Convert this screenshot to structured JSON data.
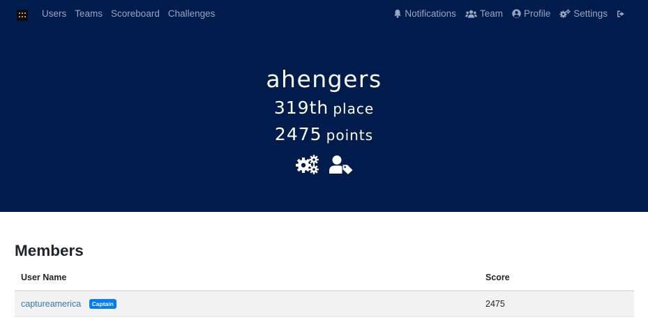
{
  "nav": {
    "left_items": [
      "Users",
      "Teams",
      "Scoreboard",
      "Challenges"
    ],
    "notifications_label": "Notifications",
    "team_label": "Team",
    "profile_label": "Profile",
    "settings_label": "Settings",
    "icons": {
      "logo": "ctf-logo",
      "notifications": "bell-icon",
      "team": "users-icon",
      "profile": "user-circle-icon",
      "settings": "cogs-icon",
      "logout": "sign-out-icon"
    }
  },
  "team": {
    "name": "ahengers",
    "place_number": "319th",
    "place_word": "place",
    "points_number": "2475",
    "points_word": "points",
    "action_icons": [
      "cogs-icon",
      "user-tag-icon"
    ]
  },
  "members": {
    "title": "Members",
    "columns": [
      "User Name",
      "Score"
    ],
    "rows": [
      {
        "name": "captureamerica",
        "badge": "Captain",
        "score": "2475"
      }
    ]
  },
  "colors": {
    "navy": "#001c4d",
    "link": "#337ab7",
    "badge": "#007bff"
  }
}
